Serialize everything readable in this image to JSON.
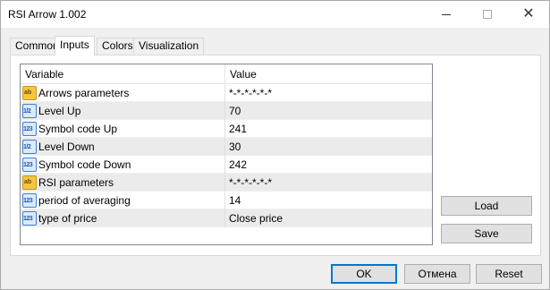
{
  "window": {
    "title": "RSI Arrow 1.002"
  },
  "tabs": [
    {
      "label": "Common"
    },
    {
      "label": "Inputs"
    },
    {
      "label": "Colors"
    },
    {
      "label": "Visualization"
    }
  ],
  "active_tab": "Inputs",
  "table": {
    "columns": [
      "Variable",
      "Value"
    ],
    "rows": [
      {
        "icon": "ab-string-icon",
        "icon_text": "ab",
        "variable": "Arrows parameters",
        "value": "*-*-*-*-*-*"
      },
      {
        "icon": "double-value-icon",
        "icon_text": "1/2",
        "variable": "Level Up",
        "value": "70"
      },
      {
        "icon": "integer-value-icon",
        "icon_text": "123",
        "variable": "Symbol code Up",
        "value": "241"
      },
      {
        "icon": "double-value-icon",
        "icon_text": "1/2",
        "variable": "Level Down",
        "value": "30"
      },
      {
        "icon": "integer-value-icon",
        "icon_text": "123",
        "variable": "Symbol code Down",
        "value": "242"
      },
      {
        "icon": "ab-string-icon",
        "icon_text": "ab",
        "variable": "RSI parameters",
        "value": "*-*-*-*-*-*"
      },
      {
        "icon": "integer-value-icon",
        "icon_text": "123",
        "variable": "period of averaging",
        "value": "14"
      },
      {
        "icon": "integer-value-icon",
        "icon_text": "123",
        "variable": "type of price",
        "value": "Close price"
      }
    ]
  },
  "side_buttons": {
    "load": "Load",
    "save": "Save"
  },
  "footer_buttons": {
    "ok": "OK",
    "cancel": "Отмена",
    "reset": "Reset"
  }
}
